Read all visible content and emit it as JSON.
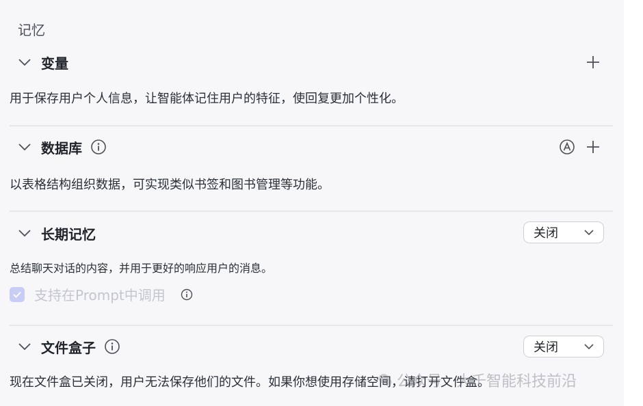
{
  "header": {
    "title": "记忆"
  },
  "sections": {
    "variables": {
      "title": "变量",
      "description": "用于保存用户个人信息，让智能体记住用户的特征，使回复更加个性化。"
    },
    "database": {
      "title": "数据库",
      "description": "以表格结构组织数据，可实现类似书签和图书管理等功能。"
    },
    "long_memory": {
      "title": "长期记忆",
      "select_value": "关闭",
      "description": "总结聊天对话的内容，并用于更好的响应用户的消息。",
      "checkbox_label": "支持在Prompt中调用",
      "checkbox_checked": true,
      "checkbox_disabled": true
    },
    "file_box": {
      "title": "文件盒子",
      "select_value": "关闭",
      "description": "现在文件盒已关闭，用户无法保存他们的文件。如果你想使用存储空间，请打开文件盒。"
    }
  },
  "watermark": {
    "text": "公众号 · 大千智能科技前沿"
  },
  "icons": {
    "chevron": "chevron-down-icon",
    "info": "info-icon",
    "plus": "plus-icon",
    "auto": "auto-a-icon",
    "check": "check-icon"
  },
  "colors": {
    "panel_bg": "#f7f7fa",
    "divider": "#e6e7eb",
    "checkbox_fill": "#c7cdf5",
    "disabled_text": "#c3c6cc"
  }
}
